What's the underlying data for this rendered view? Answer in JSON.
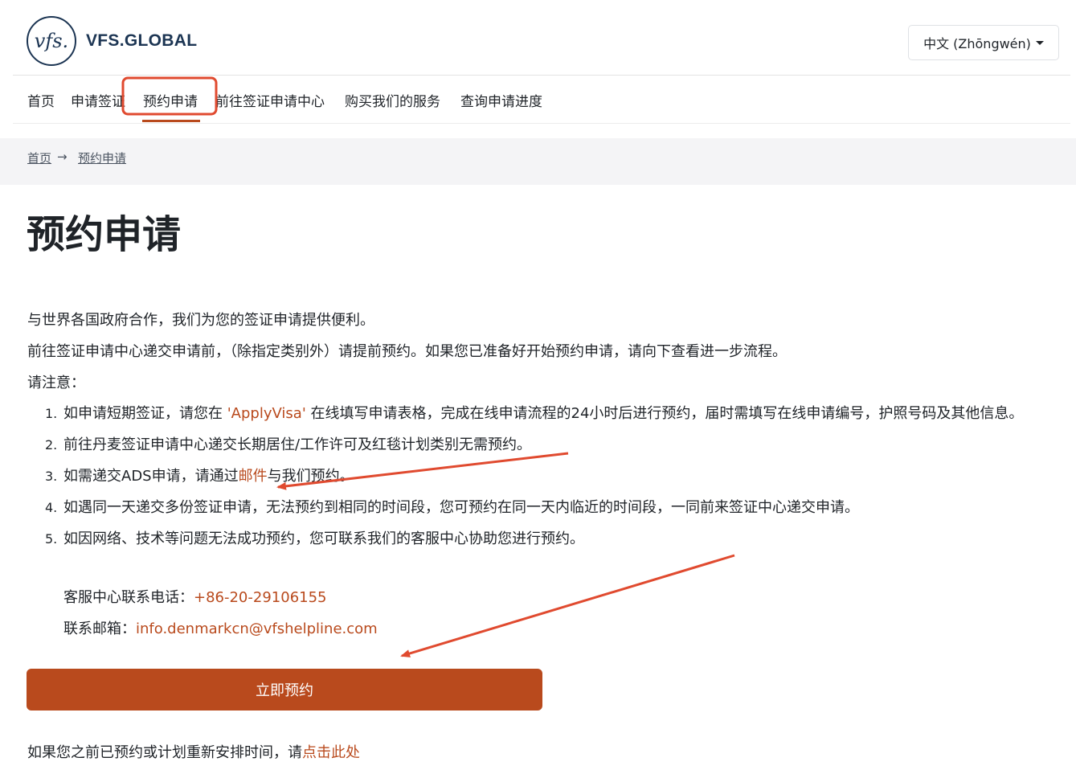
{
  "header": {
    "logo_mark": "vfs.",
    "logo_text": "VFS.GLOBAL",
    "language_button": "中文 (Zhōngwén)"
  },
  "nav": {
    "items": [
      "首页",
      "申请签证",
      "预约申请",
      "前往签证申请中心",
      "购买我们的服务",
      "查询申请进度"
    ],
    "active_index": 2
  },
  "breadcrumb": {
    "home": "首页",
    "arrow": "→",
    "current": "预约申请"
  },
  "page_title": "预约申请",
  "intro": {
    "line1": "与世界各国政府合作，我们为您的签证申请提供便利。",
    "line2": "前往签证申请中心递交申请前，（除指定类别外）请提前预约。如果您已准备好开始预约申请，请向下查看进一步流程。",
    "note_label": "请注意："
  },
  "list": {
    "item1_num": "1.",
    "item1_pre": "如申请短期签证，请您在 ",
    "item1_link": "'ApplyVisa'",
    "item1_post": " 在线填写申请表格，完成在线申请流程的24小时后进行预约，届时需填写在线申请编号，护照号码及其他信息。",
    "item2_num": "2.",
    "item2": "前往丹麦签证申请中心递交长期居住/工作许可及红毯计划类别无需预约。",
    "item3_num": "3.",
    "item3_pre": "如需递交ADS申请，请通过",
    "item3_link": "邮件",
    "item3_post": "与我们预约。",
    "item4_num": "4.",
    "item4": "如遇同一天递交多份签证申请，无法预约到相同的时间段，您可预约在同一天内临近的时间段，一同前来签证中心递交申请。",
    "item5_num": "5.",
    "item5": "如因网络、技术等问题无法成功预约，您可联系我们的客服中心协助您进行预约。"
  },
  "contact": {
    "phone_label": "客服中心联系电话：",
    "phone": "+86-20-29106155",
    "email_label": "联系邮箱：",
    "email": "info.denmarkcn@vfshelpline.com"
  },
  "book_button": "立即预约",
  "reschedule": {
    "text": "如果您之前已预约或计划重新安排时间，请",
    "link": "点击此处"
  },
  "colors": {
    "accent": "#b94a1d",
    "annotation": "#e04a2f",
    "brand_navy": "#1c3553"
  }
}
